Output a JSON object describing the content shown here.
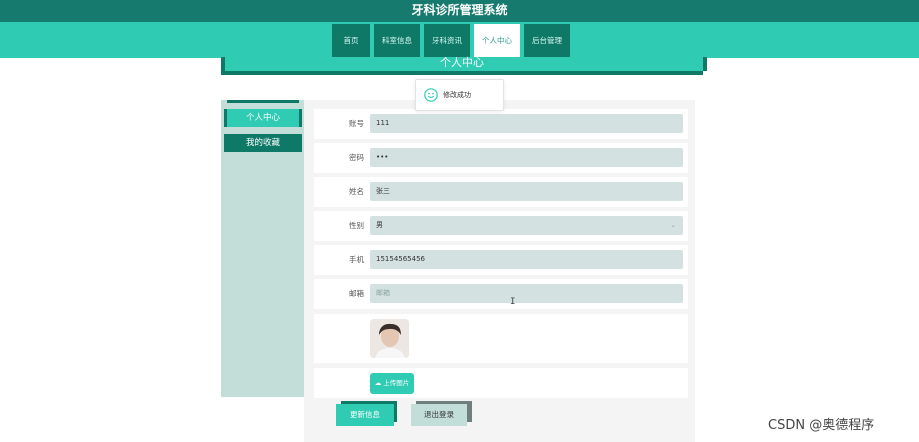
{
  "app": {
    "title": "牙科诊所管理系统"
  },
  "nav": {
    "tabs": [
      {
        "label": "首页",
        "active": false
      },
      {
        "label": "科室信息",
        "active": false
      },
      {
        "label": "牙科资讯",
        "active": false
      },
      {
        "label": "个人中心",
        "active": true
      },
      {
        "label": "后台管理",
        "active": false
      }
    ]
  },
  "section": {
    "title": "个人中心"
  },
  "toast": {
    "icon": "smile-icon",
    "message": "修改成功"
  },
  "sidebar": {
    "items": [
      {
        "label": "个人中心",
        "active": true
      },
      {
        "label": "我的收藏",
        "active": false
      }
    ]
  },
  "form": {
    "account": {
      "label": "账号",
      "value": "111"
    },
    "password": {
      "label": "密码",
      "value": "•••"
    },
    "name": {
      "label": "姓名",
      "value": "张三"
    },
    "gender": {
      "label": "性别",
      "value": "男"
    },
    "phone": {
      "label": "手机",
      "value": "15154565456"
    },
    "email": {
      "label": "邮箱",
      "placeholder": "邮箱"
    },
    "upload_label": "上传图片",
    "update_label": "更新信息",
    "logout_label": "退出登录"
  },
  "watermark": "CSDN @奥德程序",
  "colors": {
    "header_dark": "#167a6e",
    "accent": "#2fcbb3",
    "dark_teal": "#0f7968",
    "sidebar_bg": "#c3ddd9",
    "field_bg": "#d3e2e0"
  }
}
